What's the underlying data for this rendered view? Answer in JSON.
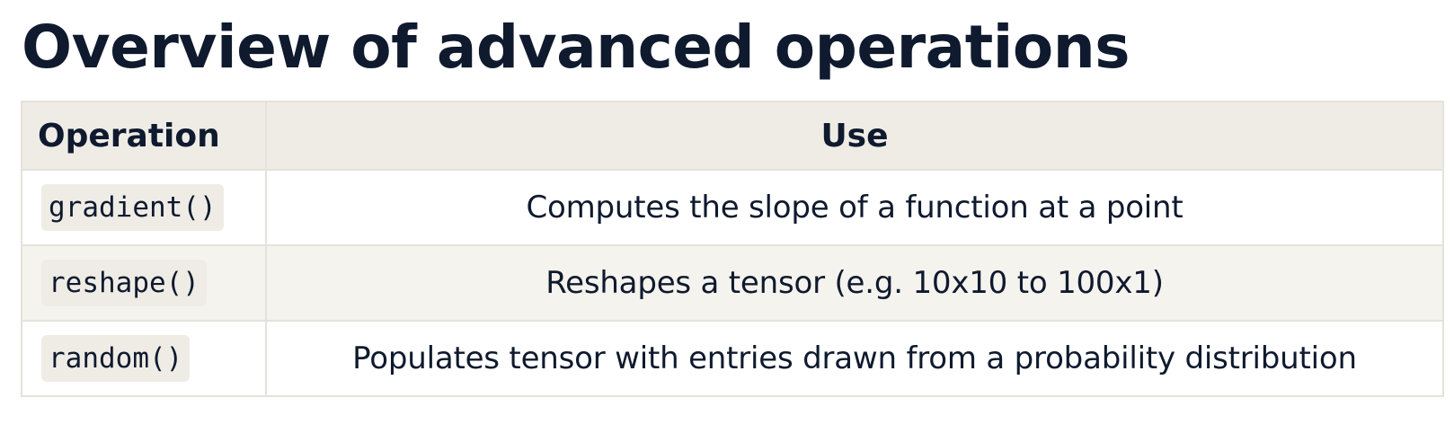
{
  "title": "Overview of advanced operations",
  "table": {
    "headers": {
      "operation": "Operation",
      "use": "Use"
    },
    "rows": [
      {
        "operation": "gradient()",
        "use": "Computes the slope of a function at a point"
      },
      {
        "operation": "reshape()",
        "use": "Reshapes a tensor (e.g. 10x10 to 100x1)"
      },
      {
        "operation": "random()",
        "use": "Populates tensor with entries drawn from a probability distribution"
      }
    ]
  }
}
